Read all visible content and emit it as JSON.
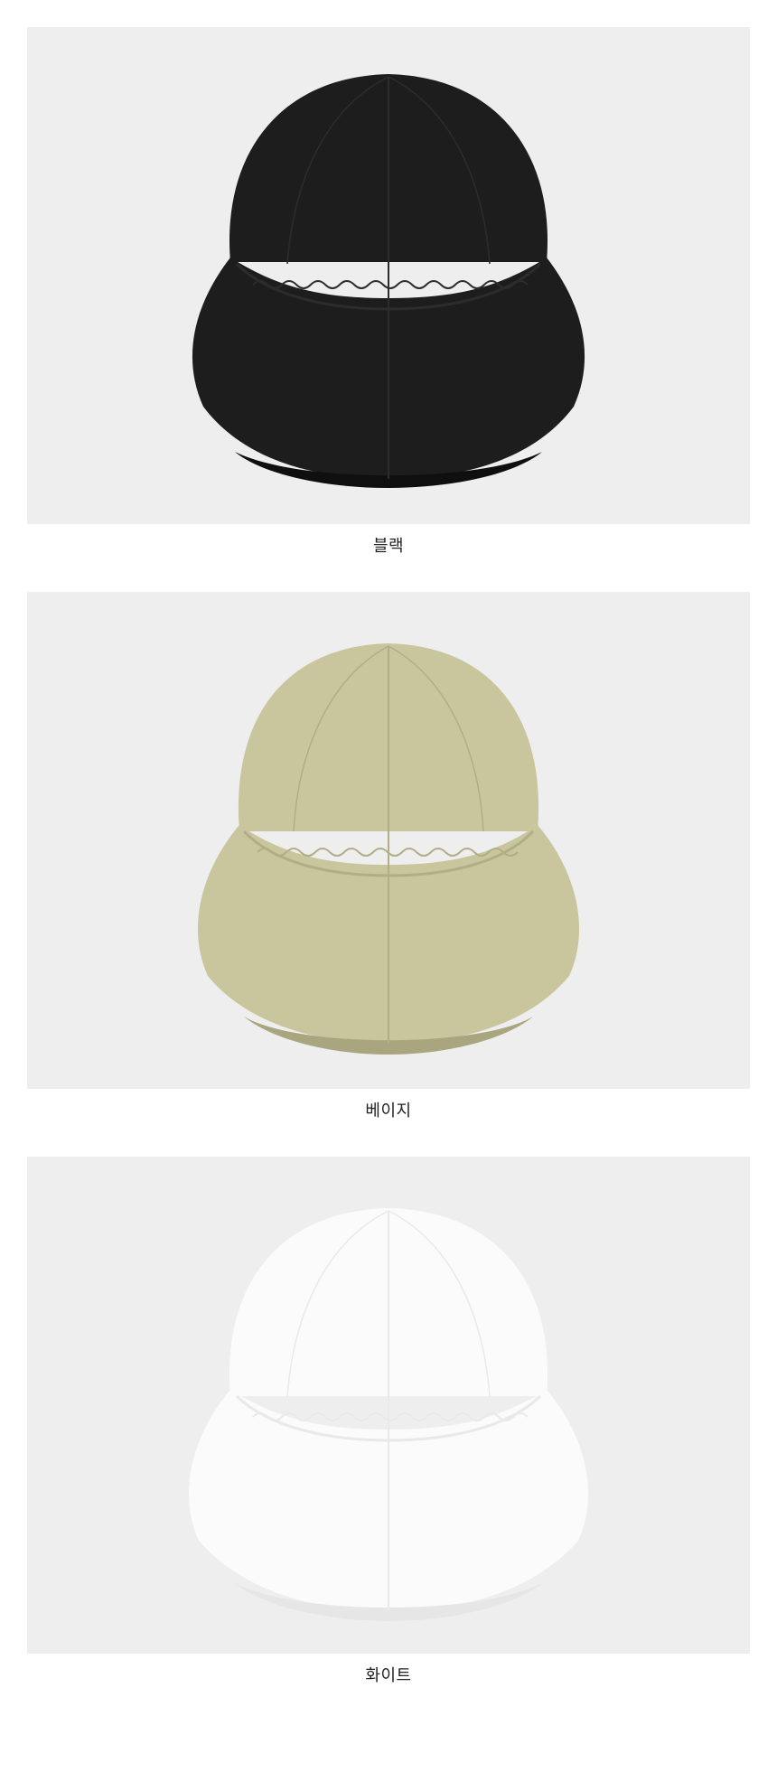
{
  "products": [
    {
      "label": "블랙",
      "image": "black-bucket-hat",
      "hat_color": "#1d1d1d",
      "hat_shadow": "#0f0f0f",
      "seam_color": "#2c2c2c",
      "backdrop": "#eeeeee"
    },
    {
      "label": "베이지",
      "image": "beige-bucket-hat",
      "hat_color": "#c9c69d",
      "hat_shadow": "#a9a67f",
      "seam_color": "#b1ae86",
      "backdrop": "#eeeeee"
    },
    {
      "label": "화이트",
      "image": "white-bucket-hat",
      "hat_color": "#fbfbfb",
      "hat_shadow": "#e6e6e6",
      "seam_color": "#e9e9e9",
      "backdrop": "#eeeeee"
    }
  ]
}
